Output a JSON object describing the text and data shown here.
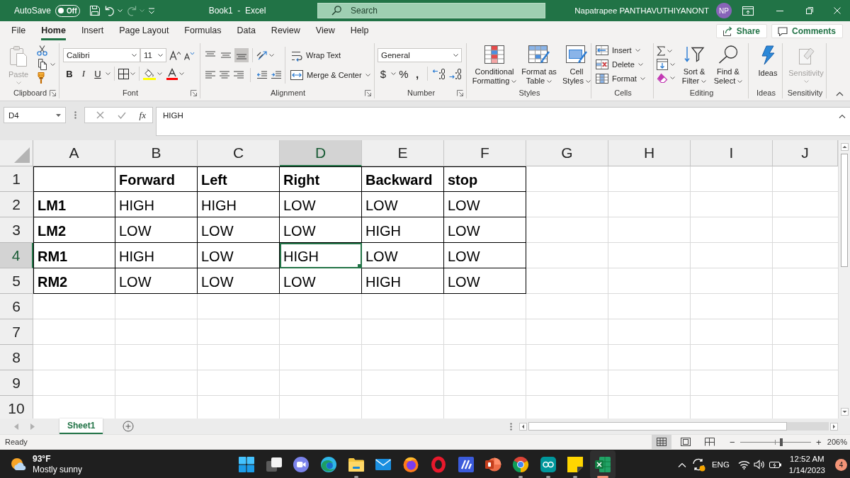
{
  "title_bar": {
    "autosave": {
      "label": "AutoSave",
      "on": false,
      "state": "Off"
    },
    "quick_access": [
      {
        "kind": "save",
        "disabled": false
      },
      {
        "kind": "undo",
        "disabled": false
      },
      {
        "kind": "redo",
        "disabled": true
      },
      {
        "kind": "customize",
        "disabled": false
      }
    ],
    "title": "Book1  -  Excel",
    "search": {
      "placeholder": "Search"
    },
    "user": {
      "name": "Napatrapee PANTHAVUTHIYANONT",
      "initials": "NP"
    }
  },
  "ribbon_tabs": [
    {
      "label": "File",
      "selected": false
    },
    {
      "label": "Home",
      "selected": true
    },
    {
      "label": "Insert",
      "selected": false
    },
    {
      "label": "Page Layout",
      "selected": false
    },
    {
      "label": "Formulas",
      "selected": false
    },
    {
      "label": "Data",
      "selected": false
    },
    {
      "label": "Review",
      "selected": false
    },
    {
      "label": "View",
      "selected": false
    },
    {
      "label": "Help",
      "selected": false
    }
  ],
  "ribbon_actions": [
    {
      "kind": "share",
      "label": "Share"
    },
    {
      "kind": "comments",
      "label": "Comments"
    }
  ],
  "ribbon": {
    "clipboard": {
      "label": "Clipboard",
      "paste": {
        "label": "Paste",
        "disabled": true
      }
    },
    "font": {
      "label": "Font",
      "font_name": "Calibri",
      "font_size": "11",
      "styles": [
        {
          "kind": "bold",
          "label": "B"
        },
        {
          "kind": "italic",
          "label": "I"
        },
        {
          "kind": "underline",
          "label": "U"
        }
      ]
    },
    "alignment": {
      "label": "Alignment",
      "vertical": [
        {
          "kind": "top",
          "selected": false
        },
        {
          "kind": "middle",
          "selected": false
        },
        {
          "kind": "bottom",
          "selected": true
        }
      ],
      "wrap_text": "Wrap Text",
      "merge": "Merge & Center"
    },
    "number": {
      "label": "Number",
      "format": "General",
      "symbols": [
        "$",
        "%",
        ","
      ]
    },
    "styles": {
      "label": "Styles",
      "buttons": [
        {
          "kind": "conditional",
          "label": "Conditional Formatting"
        },
        {
          "kind": "table",
          "label": "Format as Table"
        },
        {
          "kind": "cell_styles",
          "label": "Cell Styles"
        }
      ]
    },
    "cells": {
      "label": "Cells",
      "buttons": [
        {
          "kind": "insert",
          "label": "Insert"
        },
        {
          "kind": "delete",
          "label": "Delete"
        },
        {
          "kind": "format",
          "label": "Format"
        }
      ]
    },
    "editing": {
      "label": "Editing",
      "buttons": [
        {
          "kind": "sort",
          "label": "Sort & Filter"
        },
        {
          "kind": "find",
          "label": "Find & Select"
        }
      ]
    },
    "ideas": {
      "label": "Ideas",
      "button": "Ideas"
    },
    "sensitivity": {
      "label": "Sensitivity",
      "button": "Sensitivity",
      "disabled": true
    }
  },
  "formula_bar": {
    "name_box": "D4",
    "function_label": "fx",
    "value": "HIGH"
  },
  "sheet": {
    "columns": [
      {
        "label": "A",
        "selected": false
      },
      {
        "label": "B",
        "selected": false
      },
      {
        "label": "C",
        "selected": false
      },
      {
        "label": "D",
        "selected": true
      },
      {
        "label": "E",
        "selected": false
      },
      {
        "label": "F",
        "selected": false
      },
      {
        "label": "G",
        "selected": false
      },
      {
        "label": "H",
        "selected": false
      },
      {
        "label": "I",
        "selected": false
      },
      {
        "label": "J",
        "selected": false
      }
    ],
    "rows": [
      {
        "label": "1",
        "selected": false
      },
      {
        "label": "2",
        "selected": false
      },
      {
        "label": "3",
        "selected": false
      },
      {
        "label": "4",
        "selected": true
      },
      {
        "label": "5",
        "selected": false
      },
      {
        "label": "6",
        "selected": false
      },
      {
        "label": "7",
        "selected": false
      },
      {
        "label": "8",
        "selected": false
      },
      {
        "label": "9",
        "selected": false
      },
      {
        "label": "10",
        "selected": false
      }
    ]
  },
  "table": {
    "header": [
      "Forward",
      "Left",
      "Right",
      "Backward",
      "stop"
    ],
    "rows": [
      {
        "label": "LM1",
        "values": [
          {
            "text": "HIGH",
            "selected": false
          },
          {
            "text": "HIGH",
            "selected": false
          },
          {
            "text": "LOW",
            "selected": false
          },
          {
            "text": "LOW",
            "selected": false
          },
          {
            "text": "LOW",
            "selected": false
          }
        ]
      },
      {
        "label": "LM2",
        "values": [
          {
            "text": "LOW",
            "selected": false
          },
          {
            "text": "LOW",
            "selected": false
          },
          {
            "text": "LOW",
            "selected": false
          },
          {
            "text": "HIGH",
            "selected": false
          },
          {
            "text": "LOW",
            "selected": false
          }
        ]
      },
      {
        "label": "RM1",
        "values": [
          {
            "text": "HIGH",
            "selected": false
          },
          {
            "text": "LOW",
            "selected": false
          },
          {
            "text": "HIGH",
            "selected": true
          },
          {
            "text": "LOW",
            "selected": false
          },
          {
            "text": "LOW",
            "selected": false
          }
        ]
      },
      {
        "label": "RM2",
        "values": [
          {
            "text": "LOW",
            "selected": false
          },
          {
            "text": "LOW",
            "selected": false
          },
          {
            "text": "LOW",
            "selected": false
          },
          {
            "text": "HIGH",
            "selected": false
          },
          {
            "text": "LOW",
            "selected": false
          }
        ]
      }
    ]
  },
  "sheet_tabs": [
    {
      "label": "Sheet1",
      "selected": true
    }
  ],
  "status_bar": {
    "text": "Ready",
    "views": [
      {
        "kind": "normal",
        "selected": true
      },
      {
        "kind": "page_layout",
        "selected": false
      },
      {
        "kind": "page_break",
        "selected": false
      }
    ],
    "zoom": {
      "minus": "−",
      "plus": "+",
      "level": 0.58,
      "reading": "206%"
    }
  },
  "taskbar": {
    "weather": {
      "temperature": "93°F",
      "condition": "Mostly sunny"
    },
    "apps": [
      {
        "kind": "start",
        "running": false,
        "selected": false
      },
      {
        "kind": "task_view",
        "running": false,
        "selected": false
      },
      {
        "kind": "chat",
        "running": false,
        "selected": false
      },
      {
        "kind": "edge",
        "running": false,
        "selected": false
      },
      {
        "kind": "explorer",
        "running": true,
        "selected": false
      },
      {
        "kind": "mail",
        "running": false,
        "selected": false
      },
      {
        "kind": "firefox",
        "running": false,
        "selected": false
      },
      {
        "kind": "opera",
        "running": false,
        "selected": false
      },
      {
        "kind": "app",
        "running": false,
        "selected": false
      },
      {
        "kind": "powerpoint",
        "running": false,
        "selected": false
      },
      {
        "kind": "chrome",
        "running": true,
        "selected": false
      },
      {
        "kind": "arduino",
        "running": true,
        "selected": false
      },
      {
        "kind": "sticky_notes",
        "running": true,
        "selected": false
      },
      {
        "kind": "excel",
        "running": true,
        "selected": true
      }
    ],
    "tray": {
      "language": "ENG",
      "time": "12:52 AM",
      "date": "1/14/2023",
      "notifications": "4"
    }
  }
}
